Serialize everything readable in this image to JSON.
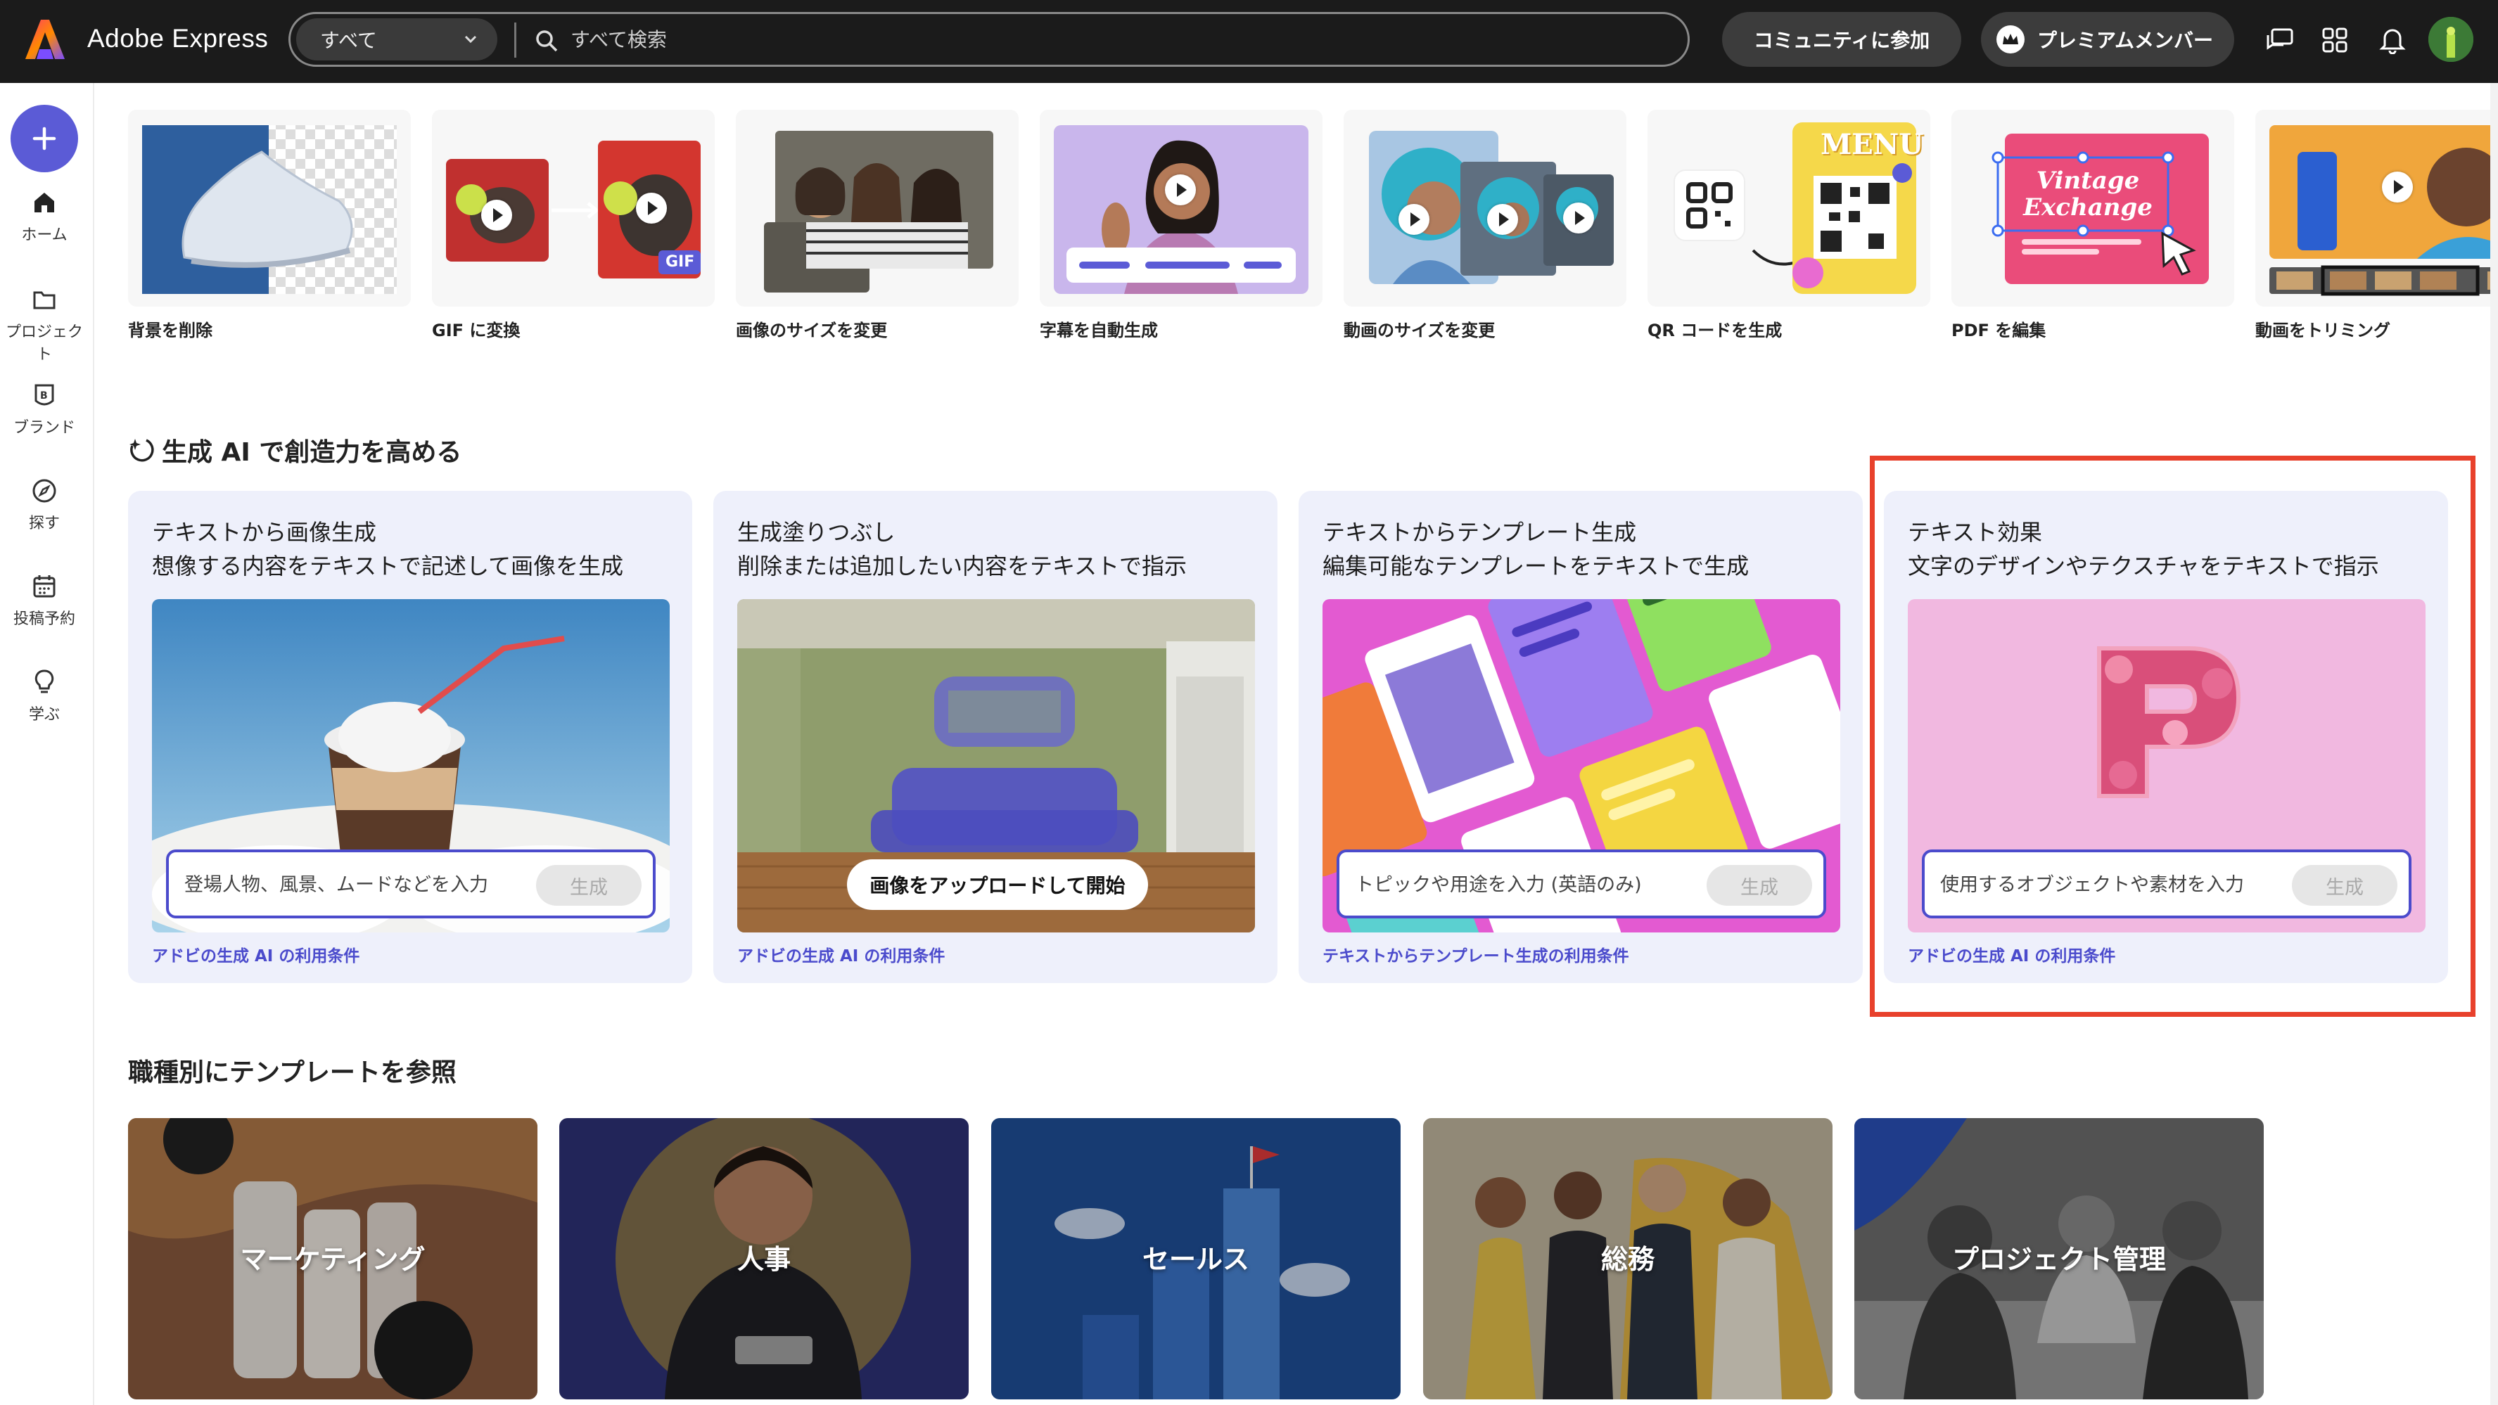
{
  "header": {
    "app_title": "Adobe Express",
    "search_scope": "すべて",
    "search_placeholder": "すべて検索",
    "community_label": "コミュニティに参加",
    "premium_label": "プレミアムメンバー"
  },
  "sidebar": {
    "items": [
      {
        "label": "ホーム",
        "icon": "home-icon"
      },
      {
        "label": "プロジェクト",
        "icon": "folder-icon"
      },
      {
        "label": "ブランド",
        "icon": "brand-icon"
      },
      {
        "label": "探す",
        "icon": "discover-icon"
      },
      {
        "label": "投稿予約",
        "icon": "calendar-icon"
      },
      {
        "label": "学ぶ",
        "icon": "lightbulb-icon"
      }
    ]
  },
  "quick_actions": [
    {
      "label": "背景を削除"
    },
    {
      "label": "GIF に変換",
      "badge": "GIF"
    },
    {
      "label": "画像のサイズを変更"
    },
    {
      "label": "字幕を自動生成"
    },
    {
      "label": "動画のサイズを変更"
    },
    {
      "label": "QR コードを生成",
      "menu_text": "MENU"
    },
    {
      "label": "PDF を編集",
      "title_text": "Vintage Exchange"
    },
    {
      "label": "動画をトリミング"
    }
  ],
  "genai": {
    "section_title": "生成 AI で創造力を高める",
    "cards": [
      {
        "title": "テキストから画像生成",
        "subtitle": "想像する内容をテキストで記述して画像を生成",
        "placeholder": "登場人物、風景、ムードなどを入力",
        "button": "生成",
        "terms": "アドビの生成 AI の利用条件"
      },
      {
        "title": "生成塗りつぶし",
        "subtitle": "削除または追加したい内容をテキストで指示",
        "button": "画像をアップロードして開始",
        "terms": "アドビの生成 AI の利用条件"
      },
      {
        "title": "テキストからテンプレート生成",
        "subtitle": "編集可能なテンプレートをテキストで生成",
        "placeholder": "トピックや用途を入力 (英語のみ)",
        "button": "生成",
        "terms": "テキストからテンプレート生成の利用条件"
      },
      {
        "title": "テキスト効果",
        "subtitle": "文字のデザインやテクスチャをテキストで指示",
        "placeholder": "使用するオブジェクトや素材を入力",
        "button": "生成",
        "terms": "アドビの生成 AI の利用条件"
      }
    ]
  },
  "jobs": {
    "section_title": "職種別にテンプレートを参照",
    "items": [
      {
        "label": "マーケティング"
      },
      {
        "label": "人事"
      },
      {
        "label": "セールス"
      },
      {
        "label": "総務"
      },
      {
        "label": "プロジェクト管理"
      }
    ]
  },
  "colors": {
    "topbar": "#1b1b1b",
    "accent": "#5b5bd6",
    "highlight": "#e8412c",
    "card_bg": "#eef0fb"
  }
}
